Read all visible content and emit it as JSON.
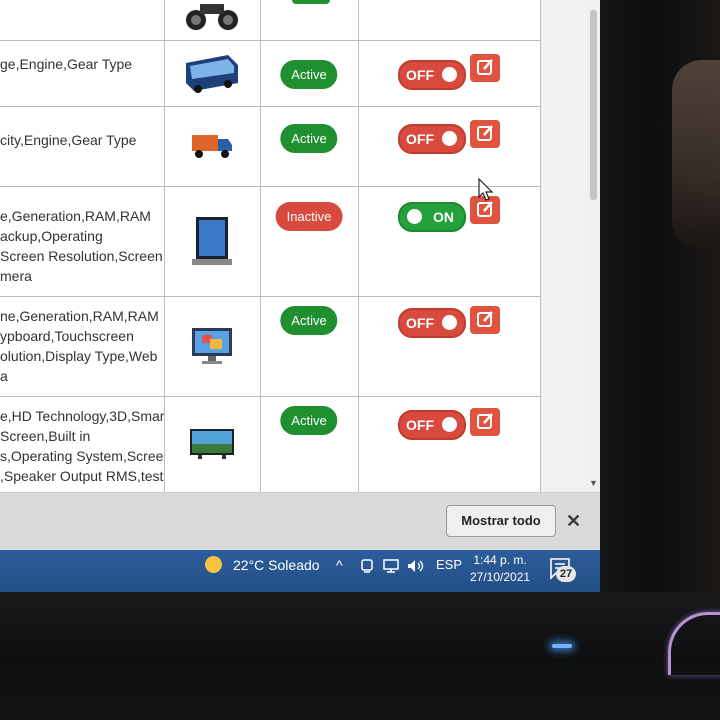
{
  "table": {
    "rows": [
      {
        "attributes": "",
        "thumb": "motorcycle-thumbnail",
        "status": "",
        "status_kind": "",
        "toggle": "",
        "toggle_state": ""
      },
      {
        "attributes": "ge,Engine,Gear Type",
        "thumb": "bus-thumbnail",
        "status": "Active",
        "status_kind": "active",
        "toggle": "OFF",
        "toggle_state": "off"
      },
      {
        "attributes": "city,Engine,Gear Type",
        "thumb": "truck-thumbnail",
        "status": "Active",
        "status_kind": "active",
        "toggle": "OFF",
        "toggle_state": "off"
      },
      {
        "attributes": "e,Generation,RAM,RAM\nackup,Operating\nScreen Resolution,Screen\nmera",
        "thumb": "laptop-thumbnail",
        "status": "Inactive",
        "status_kind": "inactive",
        "toggle": "ON",
        "toggle_state": "on"
      },
      {
        "attributes": "ne,Generation,RAM,RAM\nypboard,Touchscreen\nolution,Display Type,Web\na",
        "thumb": "desktop-thumbnail",
        "status": "Active",
        "status_kind": "active",
        "toggle": "OFF",
        "toggle_state": "off"
      },
      {
        "attributes": "e,HD Technology,3D,Smart\nScreen,Built in\ns,Operating System,Screen\n,Speaker Output RMS,test",
        "thumb": "tv-thumbnail",
        "status": "Active",
        "status_kind": "active",
        "toggle": "OFF",
        "toggle_state": "off"
      }
    ]
  },
  "notification": {
    "show_all_label": "Mostrar todo",
    "close_label": "✕"
  },
  "taskbar": {
    "weather": "22°C Soleado",
    "chevron": "^",
    "language": "ESP",
    "time": "1:44 p. m.",
    "date": "27/10/2021",
    "notification_count": "27"
  },
  "colors": {
    "active": "#1f8f2f",
    "inactive": "#d94a3e",
    "taskbar": "#2d5d9a"
  }
}
